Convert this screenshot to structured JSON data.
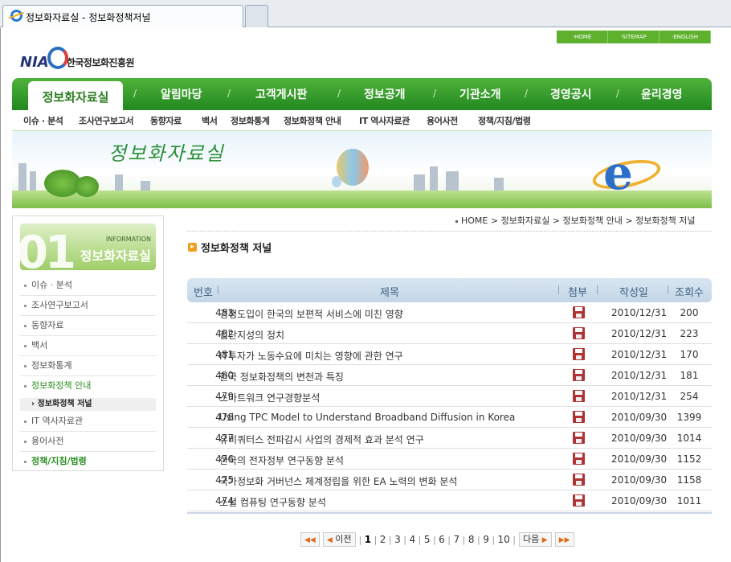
{
  "browser": {
    "tab_title": "정보화자료실 - 정보화정책저널"
  },
  "toplinks": [
    "·HOME",
    "·SITEMAP",
    "·ENGLISH"
  ],
  "logo": {
    "nia": "NIA",
    "org": "한국정보화진흥원"
  },
  "gnb": {
    "active": "정보화자료실",
    "items": [
      "알림마당",
      "고객게시판",
      "정보공개",
      "기관소개",
      "경영공시",
      "윤리경영"
    ],
    "sep": "/"
  },
  "lnb": [
    "이슈 · 분석",
    "조사연구보고서",
    "동향자료",
    "백서",
    "정보화통계",
    "정보화정책 안내",
    "IT 역사자료관",
    "용어사전",
    "정책/지침/법령"
  ],
  "banner": {
    "script": "정보화자료실"
  },
  "breadcrumb": [
    "HOME",
    "정보화자료실",
    "정보화정책 안내",
    "정보화정책 저널"
  ],
  "sidebar": {
    "num": "01",
    "en": "INFORMATION",
    "title": "정보화자료실",
    "items": [
      "이슈 · 분석",
      "조사연구보고서",
      "동향자료",
      "백서",
      "정보화통계",
      "정보화정책 안내",
      "IT 역사자료관",
      "용어사전",
      "정책/지침/법령"
    ],
    "sub": "정보화정책 저널"
  },
  "page": {
    "title": "정보화정책 저널"
  },
  "table": {
    "headers": {
      "no": "번호",
      "title": "제목",
      "attach": "첨부",
      "date": "작성일",
      "views": "조회수"
    },
    "rows": [
      {
        "no": "483",
        "title": "경쟁도입이 한국의 보편적 서비스에 미친 영향",
        "date": "2010/12/31",
        "views": "200"
      },
      {
        "no": "482",
        "title": "집단지성의 정치",
        "date": "2010/12/31",
        "views": "223"
      },
      {
        "no": "481",
        "title": "IT투자가 노동수요에 미치는 영향에 관한 연구",
        "date": "2010/12/31",
        "views": "170"
      },
      {
        "no": "480",
        "title": "한국 정보화정책의 변천과 특징",
        "date": "2010/12/31",
        "views": "181"
      },
      {
        "no": "479",
        "title": "스마트워크 연구경향분석",
        "date": "2010/12/31",
        "views": "254"
      },
      {
        "no": "478",
        "title": "Using TPC Model to Understand Broadband Diffusion in Korea",
        "date": "2010/09/30",
        "views": "1399"
      },
      {
        "no": "477",
        "title": "유비쿼터스 전파감시 사업의 경제적 효과 분석 연구",
        "date": "2010/09/30",
        "views": "1014"
      },
      {
        "no": "476",
        "title": "한국의 전자정부 연구동향 분석",
        "date": "2010/09/30",
        "views": "1152"
      },
      {
        "no": "475",
        "title": "국가정보화 거버넌스 체계정립을 위한 EA 노력의 변화 분석",
        "date": "2010/09/30",
        "views": "1158"
      },
      {
        "no": "474",
        "title": "소셜 컴퓨팅 연구동향 분석",
        "date": "2010/09/30",
        "views": "1011"
      }
    ]
  },
  "pager": {
    "prev": "이전",
    "next": "다음",
    "pages": [
      "1",
      "2",
      "3",
      "4",
      "5",
      "6",
      "7",
      "8",
      "9",
      "10"
    ],
    "current": "1"
  }
}
